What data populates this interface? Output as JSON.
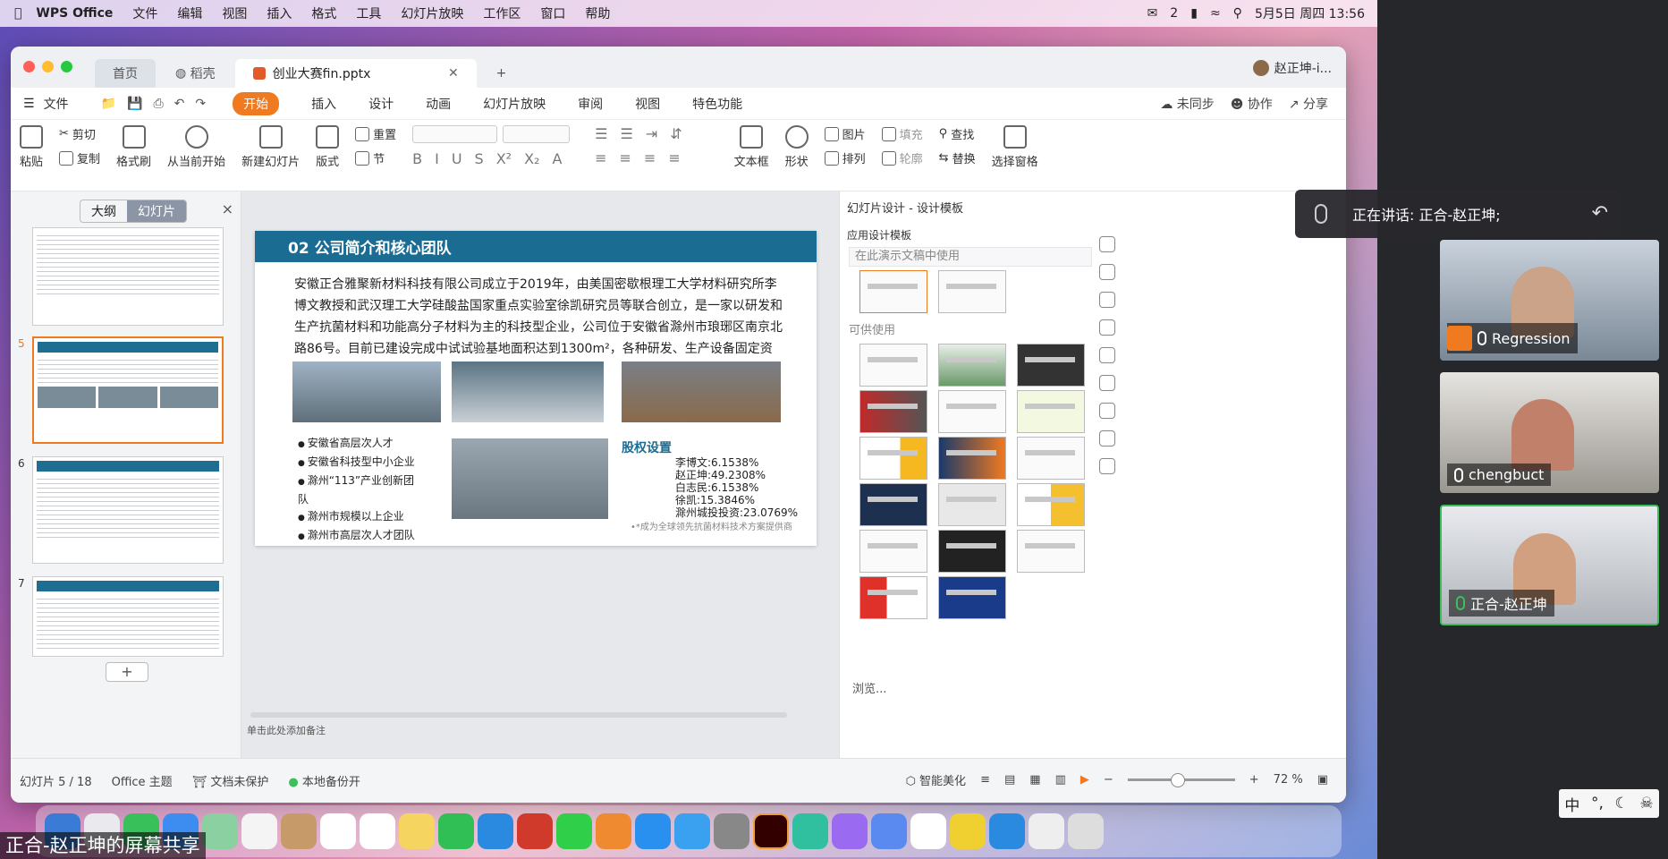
{
  "menubar": {
    "brand": "WPS Office",
    "items": [
      "文件",
      "编辑",
      "视图",
      "插入",
      "格式",
      "工具",
      "幻灯片放映",
      "工作区",
      "窗口",
      "帮助"
    ],
    "wechat_count": "2",
    "datetime": "5月5日 周四  13:56"
  },
  "tabs": {
    "home": "首页",
    "daoke": "稻壳",
    "doc": "创业大赛fin.pptx",
    "user": "赵正坤-i..."
  },
  "menurow": {
    "file": "文件",
    "items": [
      "开始",
      "插入",
      "设计",
      "动画",
      "幻灯片放映",
      "审阅",
      "视图",
      "特色功能"
    ],
    "unsynced": "未同步",
    "collab": "协作",
    "share": "分享"
  },
  "ribbon": {
    "paste": "粘贴",
    "cut": "剪切",
    "copy": "复制",
    "format_painter": "格式刷",
    "from_current": "从当前开始",
    "new_slide": "新建幻灯片",
    "layout": "版式",
    "reset": "重置",
    "section": "节",
    "textbox": "文本框",
    "shape": "形状",
    "picture": "图片",
    "fill": "填充",
    "arrange": "排列",
    "outline": "轮廓",
    "find": "查找",
    "replace": "替换",
    "select_pane": "选择窗格"
  },
  "leftpanel": {
    "outline": "大纲",
    "slides": "幻灯片",
    "close": "×",
    "slide_numbers": [
      "5",
      "6",
      "7"
    ],
    "add": "+"
  },
  "slide": {
    "header": "02  公司简介和核心团队",
    "body": "安徽正合雅聚新材料科技有限公司成立于2019年，由美国密歇根理工大学材料研究所李博文教授和武汉理工大学硅酸盐国家重点实验室徐凯研究员等联合创立，是一家以研发和生产抗菌材料和功能高分子材料为主的科技型企业，公司位于安徽省滁州市琅琊区南京北路86号。目前已建设完成中试试验基地面积达到1300m²，各种研发、生产设备固定资产近千万。",
    "bullets": [
      "安徽省高层次人才",
      "安徽省科技型中小企业",
      "滁州“113”产业创新团队",
      "滁州市规模以上企业",
      "滁州市高层次人才团队"
    ],
    "equity_title": "股权设置",
    "equity": [
      "李博文:6.1538%",
      "赵正坤:49.2308%",
      "白志民:6.1538%",
      "徐凯:15.3846%",
      "滁州城投投资:23.0769%"
    ],
    "footer": "•*成为全球领先抗菌材料技术方案提供商"
  },
  "notes": "单击此处添加备注",
  "rightpanel": {
    "title": "幻灯片设计 - 设计模板",
    "applied": "应用设计模板",
    "in_use": "在此演示文稿中使用",
    "available": "可供使用",
    "browse": "浏览..."
  },
  "statusbar": {
    "slide_pos": "幻灯片 5 / 18",
    "theme": "Office 主题",
    "protect": "文档未保护",
    "backup": "本地备份开",
    "beautify": "智能美化",
    "zoom": "72 %"
  },
  "meeting": {
    "speaking": "正在讲话: 正合-赵正坤;",
    "participants": [
      "Regression",
      "chengbuct",
      "正合-赵正坤"
    ],
    "share_caption": "正合-赵正坤的屏幕共享",
    "ime": "中"
  },
  "colors": {
    "accent": "#f07a20",
    "slide_header": "#1b6c93",
    "active_speaker": "#3cbf5c"
  }
}
